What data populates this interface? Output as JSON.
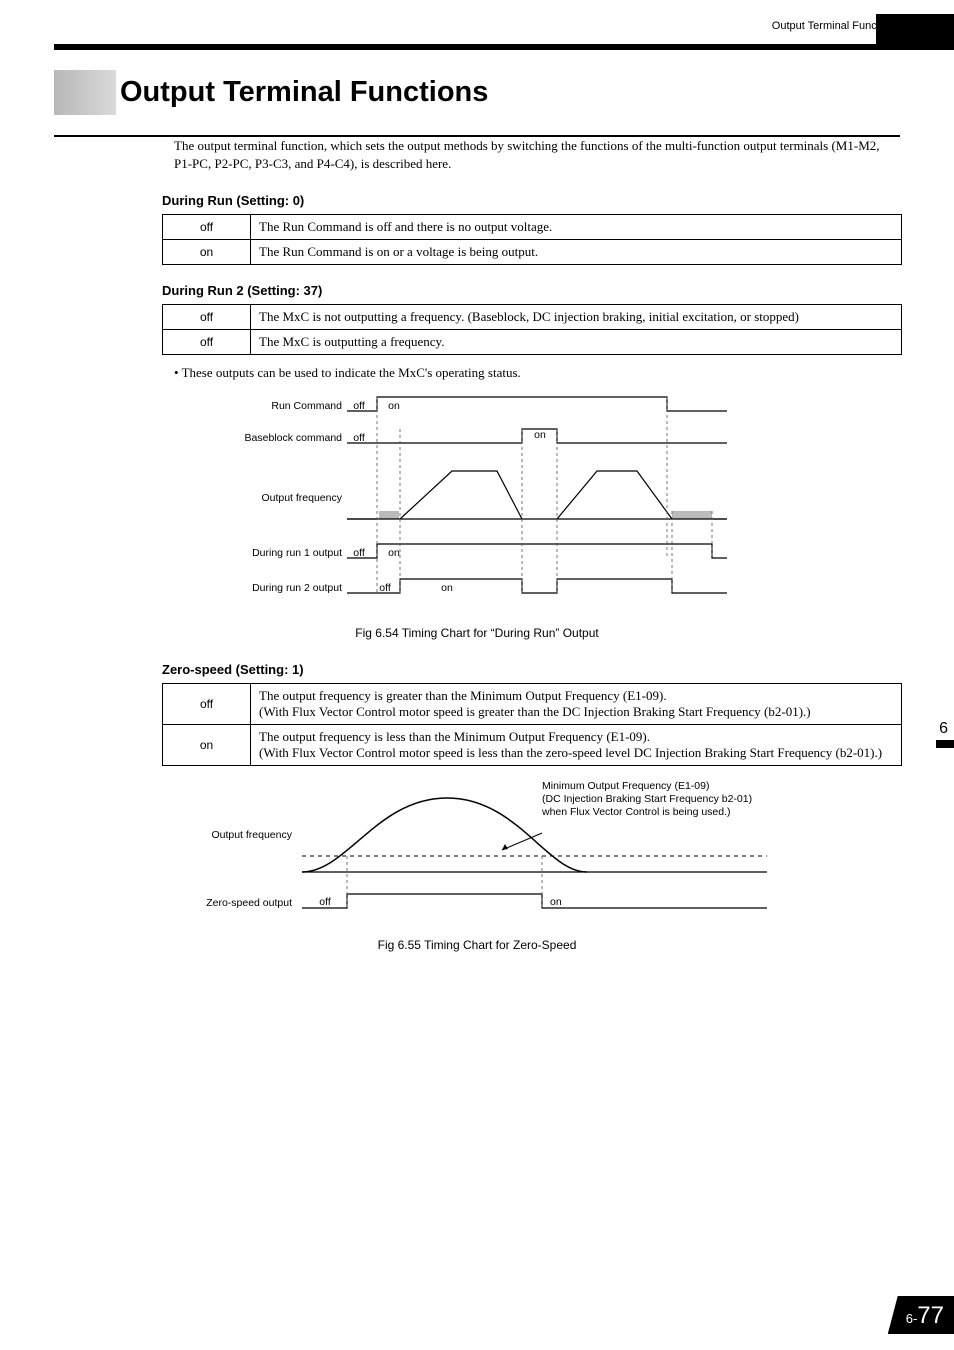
{
  "header": {
    "running_title": "Output Terminal Functions"
  },
  "title": "Output Terminal Functions",
  "intro": "The output terminal function, which sets the output methods by switching the functions of the multi-function output terminals (M1-M2, P1-PC, P2-PC, P3-C3, and P4-C4), is described here.",
  "sections": {
    "during_run": {
      "heading": "During Run (Setting: 0)",
      "rows": [
        {
          "state": "off",
          "text": "The Run Command is off and there is no output voltage."
        },
        {
          "state": "on",
          "text": "The Run Command is on or a voltage is being output."
        }
      ]
    },
    "during_run2": {
      "heading": "During Run 2 (Setting: 37)",
      "rows": [
        {
          "state": "off",
          "text": "The MxC is not outputting a frequency. (Baseblock, DC injection braking, initial excitation, or stopped)"
        },
        {
          "state": "off",
          "text": "The MxC is outputting a frequency."
        }
      ]
    },
    "bullet": "These outputs can be used to indicate the MxC's operating status.",
    "fig654": {
      "caption": "Fig 6.54  Timing Chart for “During Run” Output"
    },
    "zero_speed": {
      "heading": "Zero-speed (Setting: 1)",
      "rows": [
        {
          "state": "off",
          "text": "The output frequency is greater than the Minimum Output Frequency (E1-09).\n(With Flux Vector Control motor speed is greater than the DC Injection Braking Start Frequency (b2-01).)"
        },
        {
          "state": "on",
          "text": "The output frequency is less than the Minimum Output Frequency (E1-09).\n(With Flux Vector Control motor speed is less than the zero-speed level DC Injection Braking Start Frequency (b2-01).)"
        }
      ]
    },
    "fig655": {
      "caption": "Fig 6.55  Timing Chart for Zero-Speed"
    }
  },
  "chart654": {
    "labels": {
      "run_command": "Run Command",
      "baseblock": "Baseblock command",
      "output_freq": "Output frequency",
      "run1_output": "During run 1 output",
      "run2_output": "During run 2 output"
    },
    "states": {
      "off": "off",
      "on": "on"
    }
  },
  "chart655": {
    "labels": {
      "output_freq": "Output frequency",
      "zero_output": "Zero-speed output",
      "note": "Minimum Output Frequency (E1-09)\n(DC Injection Braking Start Frequency b2-01) when Flux Vector Control is being used.)"
    },
    "states": {
      "off": "off",
      "on": "on"
    }
  },
  "side_tab": "6",
  "footer": {
    "prefix": "6-",
    "page": "77"
  }
}
